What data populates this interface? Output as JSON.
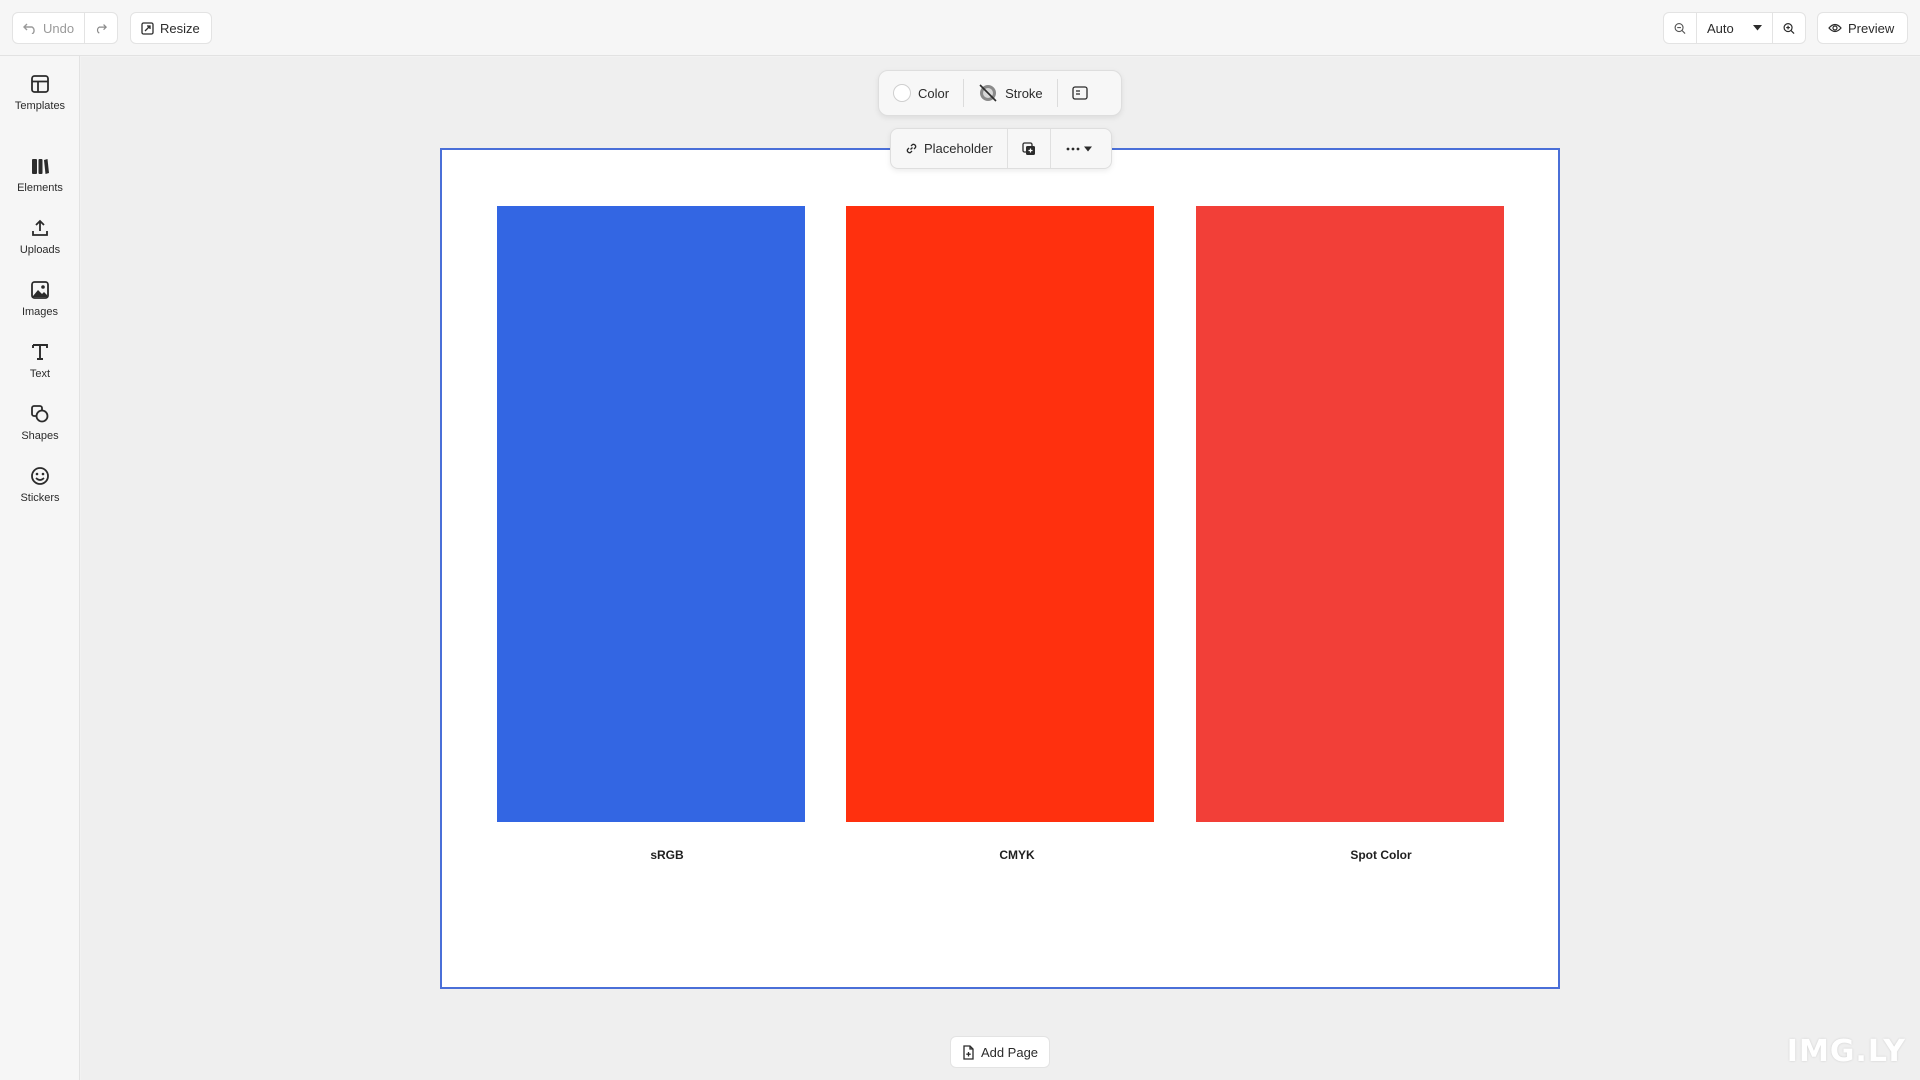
{
  "toolbar": {
    "undo_label": "Undo",
    "resize_label": "Resize",
    "zoom_value": "Auto",
    "preview_label": "Preview"
  },
  "dock": {
    "items": [
      {
        "label": "Templates",
        "icon": "templates-icon"
      },
      {
        "label": "Elements",
        "icon": "elements-icon"
      },
      {
        "label": "Uploads",
        "icon": "upload-icon"
      },
      {
        "label": "Images",
        "icon": "image-icon"
      },
      {
        "label": "Text",
        "icon": "text-icon"
      },
      {
        "label": "Shapes",
        "icon": "shapes-icon"
      },
      {
        "label": "Stickers",
        "icon": "sticker-icon"
      }
    ]
  },
  "inspector": {
    "color_label": "Color",
    "stroke_label": "Stroke"
  },
  "context": {
    "placeholder_label": "Placeholder"
  },
  "page": {
    "swatches": [
      {
        "label": "sRGB",
        "color": "#3366e3"
      },
      {
        "label": "CMYK",
        "color": "#ff300e"
      },
      {
        "label": "Spot Color",
        "color": "#f23f38"
      }
    ],
    "border_color": "#4a6fd8"
  },
  "add_page_label": "Add Page",
  "watermark": "IMG.LY"
}
